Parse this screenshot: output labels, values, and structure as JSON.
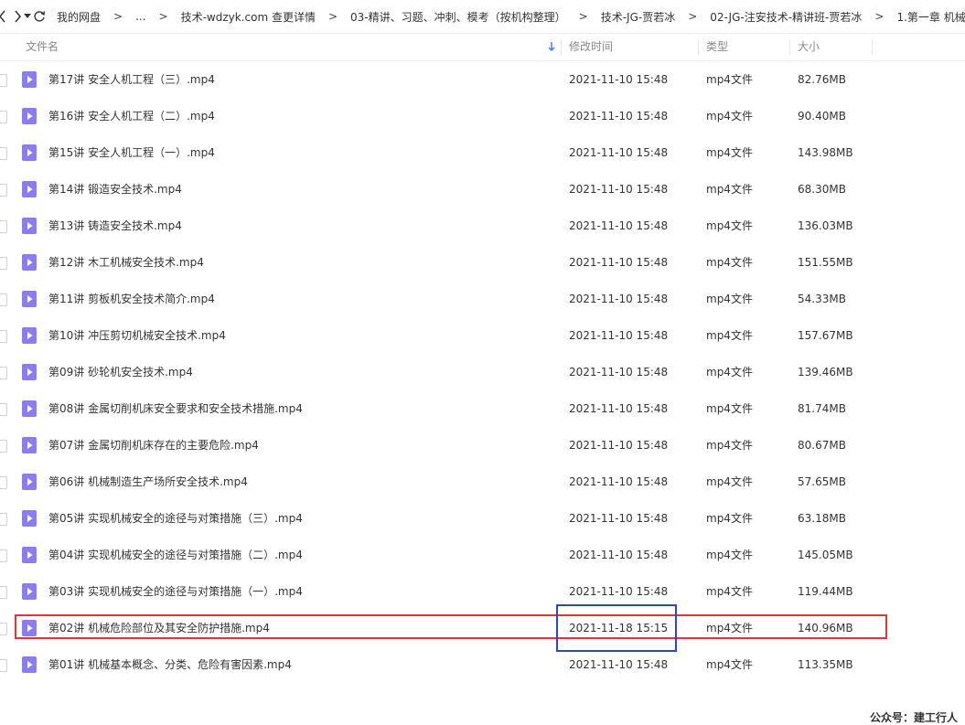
{
  "breadcrumb": [
    "我的网盘",
    "...",
    "技术-wdzyk.com 查更详情",
    "03-精讲、习题、冲刺、模考（按机构整理）",
    "技术-JG-贾若冰",
    "02-JG-注安技术-精讲班-贾若冰",
    "1.第一章  机械"
  ],
  "breadcrumb_separator": ">",
  "columns": {
    "name": "文件名",
    "modified": "修改时间",
    "type": "类型",
    "size": "大小"
  },
  "files": [
    {
      "name": "第17讲  安全人机工程（三）.mp4",
      "modified": "2021-11-10 15:48",
      "type": "mp4文件",
      "size": "82.76MB"
    },
    {
      "name": "第16讲  安全人机工程（二）.mp4",
      "modified": "2021-11-10 15:48",
      "type": "mp4文件",
      "size": "90.40MB"
    },
    {
      "name": "第15讲  安全人机工程（一）.mp4",
      "modified": "2021-11-10 15:48",
      "type": "mp4文件",
      "size": "143.98MB"
    },
    {
      "name": "第14讲  锻造安全技术.mp4",
      "modified": "2021-11-10 15:48",
      "type": "mp4文件",
      "size": "68.30MB"
    },
    {
      "name": "第13讲  铸造安全技术.mp4",
      "modified": "2021-11-10 15:48",
      "type": "mp4文件",
      "size": "136.03MB"
    },
    {
      "name": "第12讲  木工机械安全技术.mp4",
      "modified": "2021-11-10 15:48",
      "type": "mp4文件",
      "size": "151.55MB"
    },
    {
      "name": "第11讲  剪板机安全技术简介.mp4",
      "modified": "2021-11-10 15:48",
      "type": "mp4文件",
      "size": "54.33MB"
    },
    {
      "name": "第10讲  冲压剪切机械安全技术.mp4",
      "modified": "2021-11-10 15:48",
      "type": "mp4文件",
      "size": "157.67MB"
    },
    {
      "name": "第09讲  砂轮机安全技术.mp4",
      "modified": "2021-11-10 15:48",
      "type": "mp4文件",
      "size": "139.46MB"
    },
    {
      "name": "第08讲  金属切削机床安全要求和安全技术措施.mp4",
      "modified": "2021-11-10 15:48",
      "type": "mp4文件",
      "size": "81.74MB"
    },
    {
      "name": "第07讲  金属切削机床存在的主要危险.mp4",
      "modified": "2021-11-10 15:48",
      "type": "mp4文件",
      "size": "80.67MB"
    },
    {
      "name": "第06讲  机械制造生产场所安全技术.mp4",
      "modified": "2021-11-10 15:48",
      "type": "mp4文件",
      "size": "57.65MB"
    },
    {
      "name": "第05讲  实现机械安全的途径与对策措施（三）.mp4",
      "modified": "2021-11-10 15:48",
      "type": "mp4文件",
      "size": "63.18MB"
    },
    {
      "name": "第04讲  实现机械安全的途径与对策措施（二）.mp4",
      "modified": "2021-11-10 15:48",
      "type": "mp4文件",
      "size": "145.05MB"
    },
    {
      "name": "第03讲  实现机械安全的途径与对策措施（一）.mp4",
      "modified": "2021-11-10 15:48",
      "type": "mp4文件",
      "size": "119.44MB"
    },
    {
      "name": "第02讲  机械危险部位及其安全防护措施.mp4",
      "modified": "2021-11-18 15:15",
      "type": "mp4文件",
      "size": "140.96MB"
    },
    {
      "name": "第01讲  机械基本概念、分类、危险有害因素.mp4",
      "modified": "2021-11-10 15:48",
      "type": "mp4文件",
      "size": "113.35MB"
    }
  ],
  "watermark": "公众号：建工行人",
  "colors": {
    "file_icon": "#8b7cf6",
    "highlight_row_border": "#e8323a",
    "highlight_date_border": "#2f46c8",
    "sort_arrow": "#3b7cf2"
  },
  "icons": {
    "back": "chevron-left-icon",
    "forward": "chevron-right-icon",
    "history": "caret-down-icon",
    "refresh": "refresh-icon",
    "sort": "arrow-down-icon",
    "file": "video-file-icon"
  }
}
